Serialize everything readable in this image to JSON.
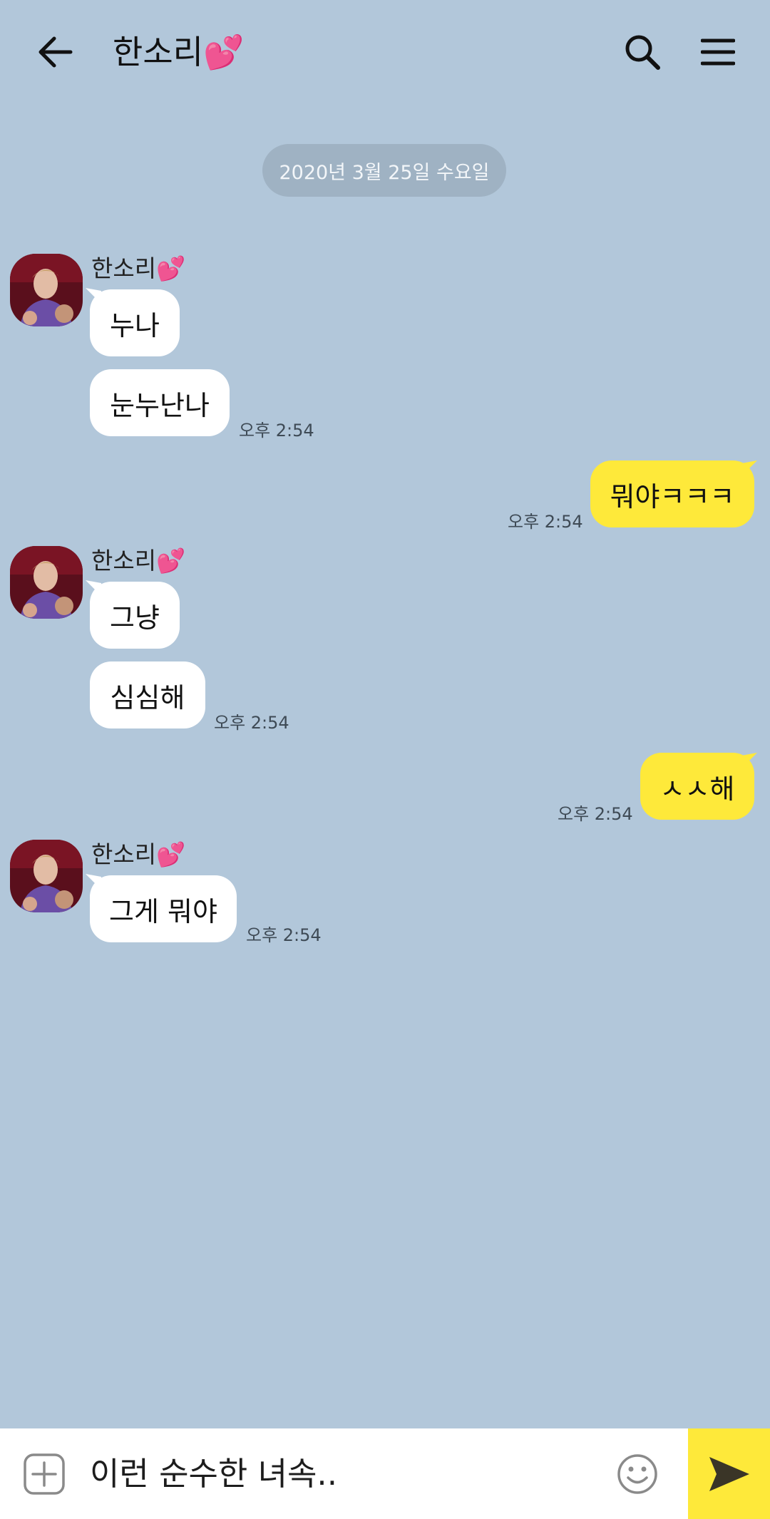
{
  "header": {
    "title": "한소리💕",
    "icons": {
      "back": "back-arrow-icon",
      "search": "search-icon",
      "menu": "hamburger-menu-icon"
    }
  },
  "date_divider": "2020년 3월 25일 수요일",
  "messages": [
    {
      "sender": "한소리💕",
      "text": "누나"
    },
    {
      "text": "눈누난나",
      "time": "오후 2:54"
    },
    {
      "text": "뭐야ㅋㅋㅋ",
      "time": "오후 2:54",
      "outgoing": true
    },
    {
      "sender": "한소리💕",
      "text": "그냥"
    },
    {
      "text": "심심해",
      "time": "오후 2:54"
    },
    {
      "text": "ㅅㅅ해",
      "time": "오후 2:54",
      "outgoing": true
    },
    {
      "sender": "한소리💕",
      "text": "그게 뭐야",
      "time": "오후 2:54"
    }
  ],
  "input": {
    "value": "이런 순수한 녀속.."
  },
  "colors": {
    "background": "#b2c7da",
    "outgoing_bubble": "#fee93a",
    "incoming_bubble": "#ffffff"
  }
}
